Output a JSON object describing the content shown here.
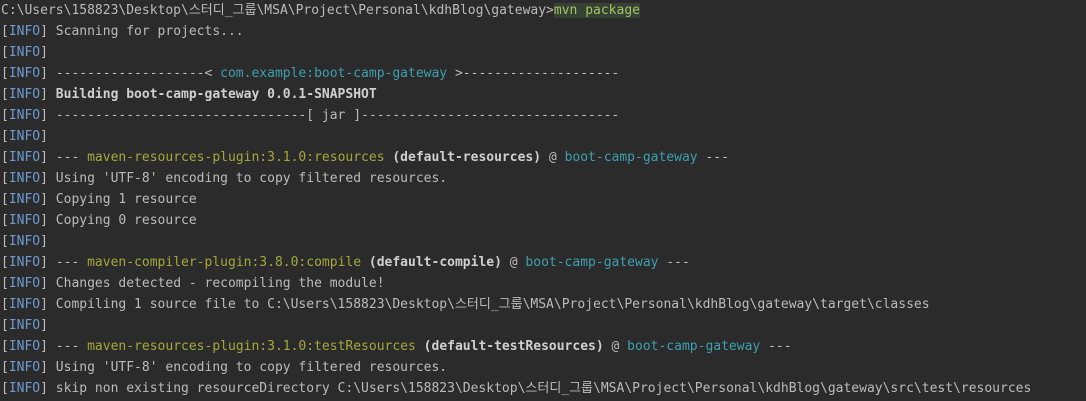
{
  "prompt": {
    "path": "C:\\Users\\158823\\Desktop\\스터디_그룹\\MSA\\Project\\Personal\\kdhBlog\\gateway>",
    "command": "mvn package"
  },
  "tag": "INFO",
  "lines": [
    {
      "text": " Scanning for projects..."
    },
    {
      "text": ""
    },
    {
      "pre": " -------------------< ",
      "artifact": "com.example:boot-camp-gateway",
      "post": " >--------------------"
    },
    {
      "bold": " Building boot-camp-gateway 0.0.1-SNAPSHOT"
    },
    {
      "text": " --------------------------------[ jar ]---------------------------------"
    },
    {
      "text": ""
    },
    {
      "pre": " --- ",
      "plugin": "maven-resources-plugin:3.1.0:resources",
      "boldmid": " (default-resources)",
      "at": " @ ",
      "artifact": "boot-camp-gateway",
      "post": " ---"
    },
    {
      "text": " Using 'UTF-8' encoding to copy filtered resources."
    },
    {
      "text": " Copying 1 resource"
    },
    {
      "text": " Copying 0 resource"
    },
    {
      "text": ""
    },
    {
      "pre": " --- ",
      "plugin": "maven-compiler-plugin:3.8.0:compile",
      "boldmid": " (default-compile)",
      "at": " @ ",
      "artifact": "boot-camp-gateway",
      "post": " ---"
    },
    {
      "text": " Changes detected - recompiling the module!"
    },
    {
      "text": " Compiling 1 source file to C:\\Users\\158823\\Desktop\\스터디_그룹\\MSA\\Project\\Personal\\kdhBlog\\gateway\\target\\classes"
    },
    {
      "text": ""
    },
    {
      "pre": " --- ",
      "plugin": "maven-resources-plugin:3.1.0:testResources",
      "boldmid": " (default-testResources)",
      "at": " @ ",
      "artifact": "boot-camp-gateway",
      "post": " ---"
    },
    {
      "text": " Using 'UTF-8' encoding to copy filtered resources."
    },
    {
      "text": " skip non existing resourceDirectory C:\\Users\\158823\\Desktop\\스터디_그룹\\MSA\\Project\\Personal\\kdhBlog\\gateway\\src\\test\\resources"
    }
  ],
  "colors": {
    "background": "#2b2b2b",
    "text": "#bbbbbb",
    "info_tag": "#6c9bd4",
    "plugin": "#a5a83a",
    "artifact": "#3d9fb0",
    "command": "#a5c261"
  }
}
